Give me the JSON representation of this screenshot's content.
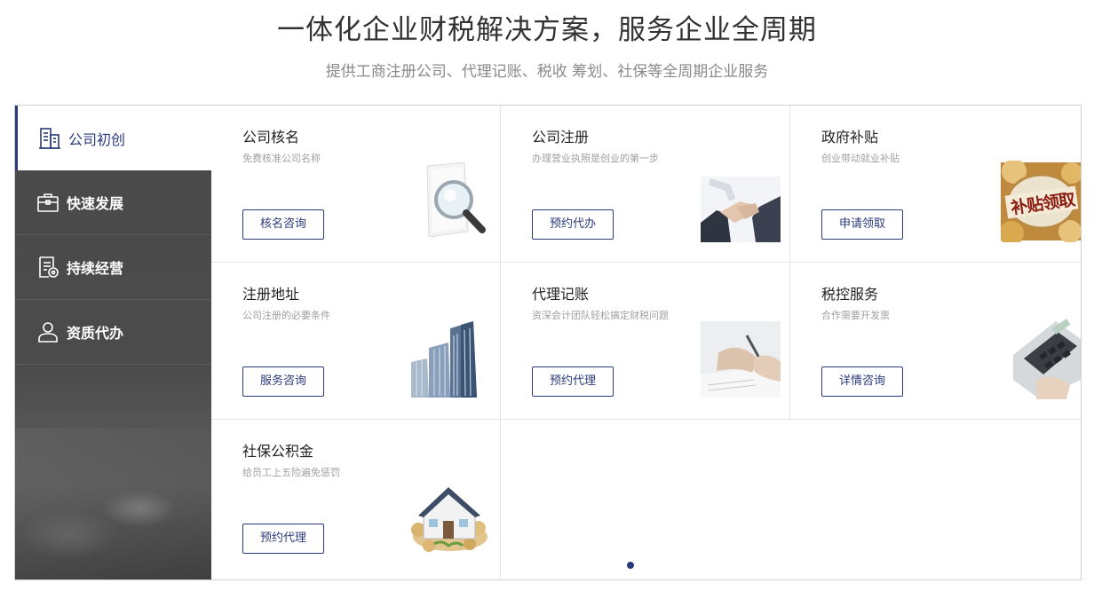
{
  "header": {
    "title": "一体化企业财税解决方案，服务企业全周期",
    "subtitle": "提供工商注册公司、代理记账、税收 筹划、社保等全周期企业服务"
  },
  "sidebar": {
    "items": [
      {
        "label": "公司初创",
        "icon": "building-icon",
        "active": true
      },
      {
        "label": "快速发展",
        "icon": "briefcase-icon",
        "active": false
      },
      {
        "label": "持续经营",
        "icon": "document-icon",
        "active": false
      },
      {
        "label": "资质代办",
        "icon": "person-icon",
        "active": false
      }
    ]
  },
  "cards": [
    {
      "title": "公司核名",
      "desc": "免费核准公司名称",
      "button": "核名咨询",
      "image": "magnifier-document-image"
    },
    {
      "title": "公司注册",
      "desc": "办理营业执照是创业的第一步",
      "button": "预约代办",
      "image": "handshake-image"
    },
    {
      "title": "政府补贴",
      "desc": "创业带动就业补贴",
      "button": "申请领取",
      "image": "subsidy-coins-image",
      "image_text": "补贴领取"
    },
    {
      "title": "注册地址",
      "desc": "公司注册的必要条件",
      "button": "服务咨询",
      "image": "office-building-image"
    },
    {
      "title": "代理记账",
      "desc": "资深会计团队轻松搞定财税问题",
      "button": "预约代理",
      "image": "writing-hand-image"
    },
    {
      "title": "税控服务",
      "desc": "合作需要开发票",
      "button": "详情咨询",
      "image": "calculator-image"
    },
    {
      "title": "社保公积金",
      "desc": "给员工上五险遍免惩罚",
      "button": "预约代理",
      "image": "house-coins-image"
    }
  ],
  "pagination": {
    "current": 1,
    "total": 1
  },
  "colors": {
    "accent": "#2b3a7a",
    "sidebar_bg": "#4a4a4a",
    "muted": "#a0a0a0"
  }
}
